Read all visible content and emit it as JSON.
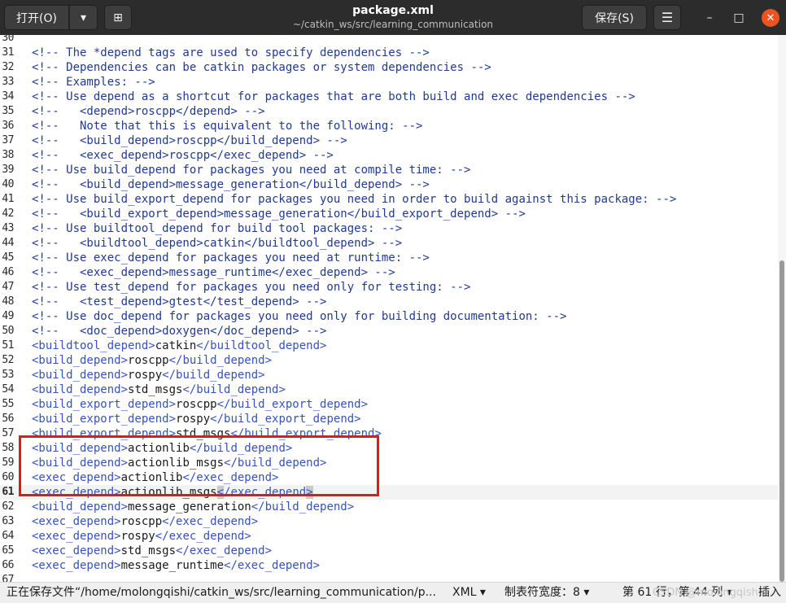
{
  "header": {
    "open_label": "打开(O)",
    "open_dropdown_glyph": "▾",
    "new_tab_glyph": "⊞",
    "title": "package.xml",
    "subtitle": "~/catkin_ws/src/learning_communication",
    "save_label": "保存(S)",
    "menu_glyph": "☰",
    "minimize_glyph": "–",
    "maximize_glyph": "□",
    "close_glyph": "✕"
  },
  "editor": {
    "current_line": 61,
    "lines": [
      {
        "n": "30",
        "segs": [
          {
            "c": "c",
            "t": ""
          }
        ]
      },
      {
        "n": "31",
        "segs": [
          {
            "c": "c",
            "t": "<!-- The *depend tags are used to specify dependencies -->"
          }
        ]
      },
      {
        "n": "32",
        "segs": [
          {
            "c": "c",
            "t": "<!-- Dependencies can be catkin packages or system dependencies -->"
          }
        ]
      },
      {
        "n": "33",
        "segs": [
          {
            "c": "c",
            "t": "<!-- Examples: -->"
          }
        ]
      },
      {
        "n": "34",
        "segs": [
          {
            "c": "c",
            "t": "<!-- Use depend as a shortcut for packages that are both build and exec dependencies -->"
          }
        ]
      },
      {
        "n": "35",
        "segs": [
          {
            "c": "c",
            "t": "<!--   <depend>roscpp</depend> -->"
          }
        ]
      },
      {
        "n": "36",
        "segs": [
          {
            "c": "c",
            "t": "<!--   Note that this is equivalent to the following: -->"
          }
        ]
      },
      {
        "n": "37",
        "segs": [
          {
            "c": "c",
            "t": "<!--   <build_depend>roscpp</build_depend> -->"
          }
        ]
      },
      {
        "n": "38",
        "segs": [
          {
            "c": "c",
            "t": "<!--   <exec_depend>roscpp</exec_depend> -->"
          }
        ]
      },
      {
        "n": "39",
        "segs": [
          {
            "c": "c",
            "t": "<!-- Use build_depend for packages you need at compile time: -->"
          }
        ]
      },
      {
        "n": "40",
        "segs": [
          {
            "c": "c",
            "t": "<!--   <build_depend>message_generation</build_depend> -->"
          }
        ]
      },
      {
        "n": "41",
        "segs": [
          {
            "c": "c",
            "t": "<!-- Use build_export_depend for packages you need in order to build against this package: -->"
          }
        ]
      },
      {
        "n": "42",
        "segs": [
          {
            "c": "c",
            "t": "<!--   <build_export_depend>message_generation</build_export_depend> -->"
          }
        ]
      },
      {
        "n": "43",
        "segs": [
          {
            "c": "c",
            "t": "<!-- Use buildtool_depend for build tool packages: -->"
          }
        ]
      },
      {
        "n": "44",
        "segs": [
          {
            "c": "c",
            "t": "<!--   <buildtool_depend>catkin</buildtool_depend> -->"
          }
        ]
      },
      {
        "n": "45",
        "segs": [
          {
            "c": "c",
            "t": "<!-- Use exec_depend for packages you need at runtime: -->"
          }
        ]
      },
      {
        "n": "46",
        "segs": [
          {
            "c": "c",
            "t": "<!--   <exec_depend>message_runtime</exec_depend> -->"
          }
        ]
      },
      {
        "n": "47",
        "segs": [
          {
            "c": "c",
            "t": "<!-- Use test_depend for packages you need only for testing: -->"
          }
        ]
      },
      {
        "n": "48",
        "segs": [
          {
            "c": "c",
            "t": "<!--   <test_depend>gtest</test_depend> -->"
          }
        ]
      },
      {
        "n": "49",
        "segs": [
          {
            "c": "c",
            "t": "<!-- Use doc_depend for packages you need only for building documentation: -->"
          }
        ]
      },
      {
        "n": "50",
        "segs": [
          {
            "c": "c",
            "t": "<!--   <doc_depend>doxygen</doc_depend> -->"
          }
        ]
      },
      {
        "n": "51",
        "segs": [
          {
            "c": "t",
            "t": "<buildtool_depend>"
          },
          {
            "c": "x",
            "t": "catkin"
          },
          {
            "c": "t",
            "t": "</buildtool_depend>"
          }
        ]
      },
      {
        "n": "52",
        "segs": [
          {
            "c": "t",
            "t": "<build_depend>"
          },
          {
            "c": "x",
            "t": "roscpp"
          },
          {
            "c": "t",
            "t": "</build_depend>"
          }
        ]
      },
      {
        "n": "53",
        "segs": [
          {
            "c": "t",
            "t": "<build_depend>"
          },
          {
            "c": "x",
            "t": "rospy"
          },
          {
            "c": "t",
            "t": "</build_depend>"
          }
        ]
      },
      {
        "n": "54",
        "segs": [
          {
            "c": "t",
            "t": "<build_depend>"
          },
          {
            "c": "x",
            "t": "std_msgs"
          },
          {
            "c": "t",
            "t": "</build_depend>"
          }
        ]
      },
      {
        "n": "55",
        "segs": [
          {
            "c": "t",
            "t": "<build_export_depend>"
          },
          {
            "c": "x",
            "t": "roscpp"
          },
          {
            "c": "t",
            "t": "</build_export_depend>"
          }
        ]
      },
      {
        "n": "56",
        "segs": [
          {
            "c": "t",
            "t": "<build_export_depend>"
          },
          {
            "c": "x",
            "t": "rospy"
          },
          {
            "c": "t",
            "t": "</build_export_depend>"
          }
        ]
      },
      {
        "n": "57",
        "segs": [
          {
            "c": "t",
            "t": "<build_export_depend>"
          },
          {
            "c": "x",
            "t": "std_msgs"
          },
          {
            "c": "t",
            "t": "</build_export_depend>"
          }
        ]
      },
      {
        "n": "58",
        "segs": [
          {
            "c": "t",
            "t": "<build_depend>"
          },
          {
            "c": "x",
            "t": "actionlib"
          },
          {
            "c": "t",
            "t": "</build_depend>"
          }
        ]
      },
      {
        "n": "59",
        "segs": [
          {
            "c": "t",
            "t": "<build_depend>"
          },
          {
            "c": "x",
            "t": "actionlib_msgs"
          },
          {
            "c": "t",
            "t": "</build_depend>"
          }
        ]
      },
      {
        "n": "60",
        "segs": [
          {
            "c": "t",
            "t": "<exec_depend>"
          },
          {
            "c": "x",
            "t": "actionlib"
          },
          {
            "c": "t",
            "t": "</exec_depend>"
          }
        ]
      },
      {
        "n": "61",
        "segs": [
          {
            "c": "t",
            "t": "<exec_depend>"
          },
          {
            "c": "x",
            "t": "actionlib_msgs"
          },
          {
            "c": "m",
            "t": "<"
          },
          {
            "c": "t",
            "t": "/exec_depend"
          },
          {
            "c": "m",
            "t": ">"
          }
        ]
      },
      {
        "n": "62",
        "segs": [
          {
            "c": "t",
            "t": "<build_depend>"
          },
          {
            "c": "x",
            "t": "message_generation"
          },
          {
            "c": "t",
            "t": "</build_depend>"
          }
        ]
      },
      {
        "n": "63",
        "segs": [
          {
            "c": "t",
            "t": "<exec_depend>"
          },
          {
            "c": "x",
            "t": "roscpp"
          },
          {
            "c": "t",
            "t": "</exec_depend>"
          }
        ]
      },
      {
        "n": "64",
        "segs": [
          {
            "c": "t",
            "t": "<exec_depend>"
          },
          {
            "c": "x",
            "t": "rospy"
          },
          {
            "c": "t",
            "t": "</exec_depend>"
          }
        ]
      },
      {
        "n": "65",
        "segs": [
          {
            "c": "t",
            "t": "<exec_depend>"
          },
          {
            "c": "x",
            "t": "std_msgs"
          },
          {
            "c": "t",
            "t": "</exec_depend>"
          }
        ]
      },
      {
        "n": "66",
        "segs": [
          {
            "c": "t",
            "t": "<exec_depend>"
          },
          {
            "c": "x",
            "t": "message_runtime"
          },
          {
            "c": "t",
            "t": "</exec_depend>"
          }
        ]
      },
      {
        "n": "67",
        "segs": [
          {
            "c": "x",
            "t": ""
          }
        ]
      }
    ]
  },
  "status": {
    "message": "正在保存文件“/home/molongqishi/catkin_ws/src/learning_communication/p...",
    "language": "XML ▾",
    "tab_width": "制表符宽度：8 ▾",
    "position": "第 61 行，第 44 列 ▾",
    "mode": "插入",
    "watermark": "CSDN @molongqishi"
  },
  "colors": {
    "header_bg": "#2c2c2c",
    "comment": "#203a94",
    "tag": "#3652c0",
    "annotation_box": "#e01919",
    "close_button": "#e95420"
  }
}
